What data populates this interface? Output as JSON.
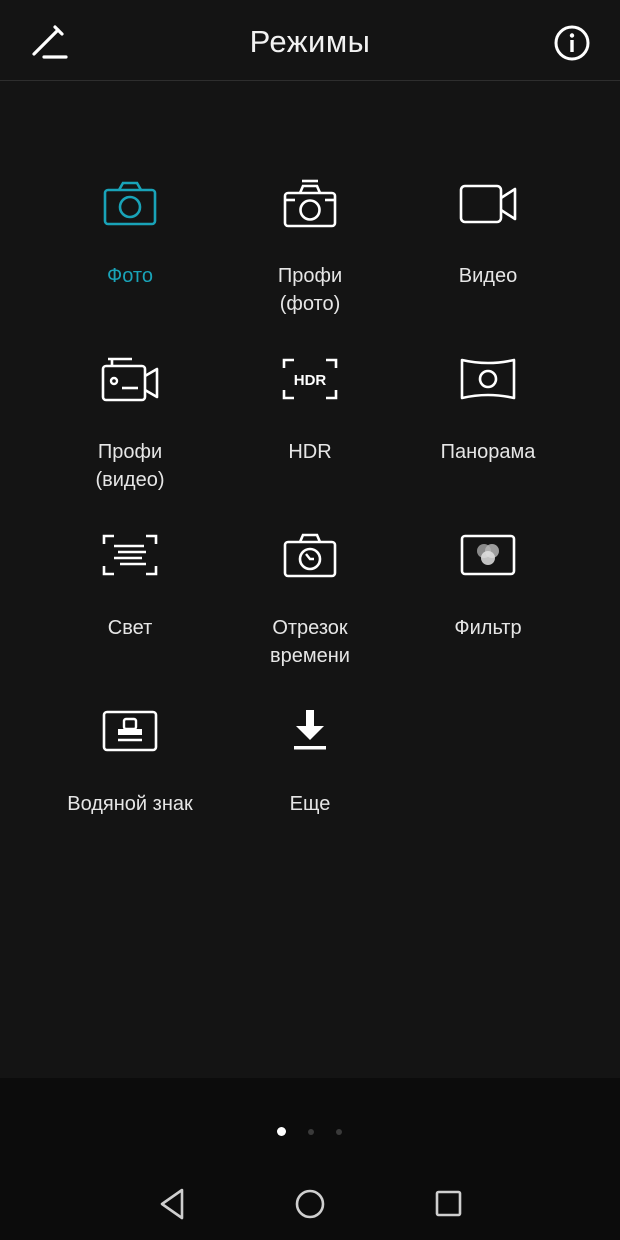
{
  "header": {
    "title": "Режимы",
    "edit_icon": "pencil-icon",
    "info_icon": "info-icon"
  },
  "colors": {
    "background": "#141414",
    "accent": "#19a3b8",
    "text": "#e6e6e6",
    "nav_bar": "#0c0c0c"
  },
  "modes": [
    {
      "label": "Фото",
      "icon": "camera-icon",
      "active": true
    },
    {
      "label": "Профи\n(фото)",
      "icon": "pro-camera-icon",
      "active": false
    },
    {
      "label": "Видео",
      "icon": "video-camera-icon",
      "active": false
    },
    {
      "label": "Профи\n(видео)",
      "icon": "pro-video-icon",
      "active": false
    },
    {
      "label": "HDR",
      "icon": "hdr-icon",
      "active": false
    },
    {
      "label": "Панорама",
      "icon": "panorama-icon",
      "active": false
    },
    {
      "label": "Свет",
      "icon": "light-icon",
      "active": false
    },
    {
      "label": "Отрезок\nвремени",
      "icon": "timelapse-icon",
      "active": false
    },
    {
      "label": "Фильтр",
      "icon": "filter-icon",
      "active": false
    },
    {
      "label": "Водяной знак",
      "icon": "watermark-icon",
      "active": false
    },
    {
      "label": "Еще",
      "icon": "download-icon",
      "active": false
    }
  ],
  "pager": {
    "pages": 3,
    "current": 1
  },
  "navbar": {
    "back_icon": "back-triangle-icon",
    "home_icon": "home-circle-icon",
    "recents_icon": "recents-square-icon"
  }
}
